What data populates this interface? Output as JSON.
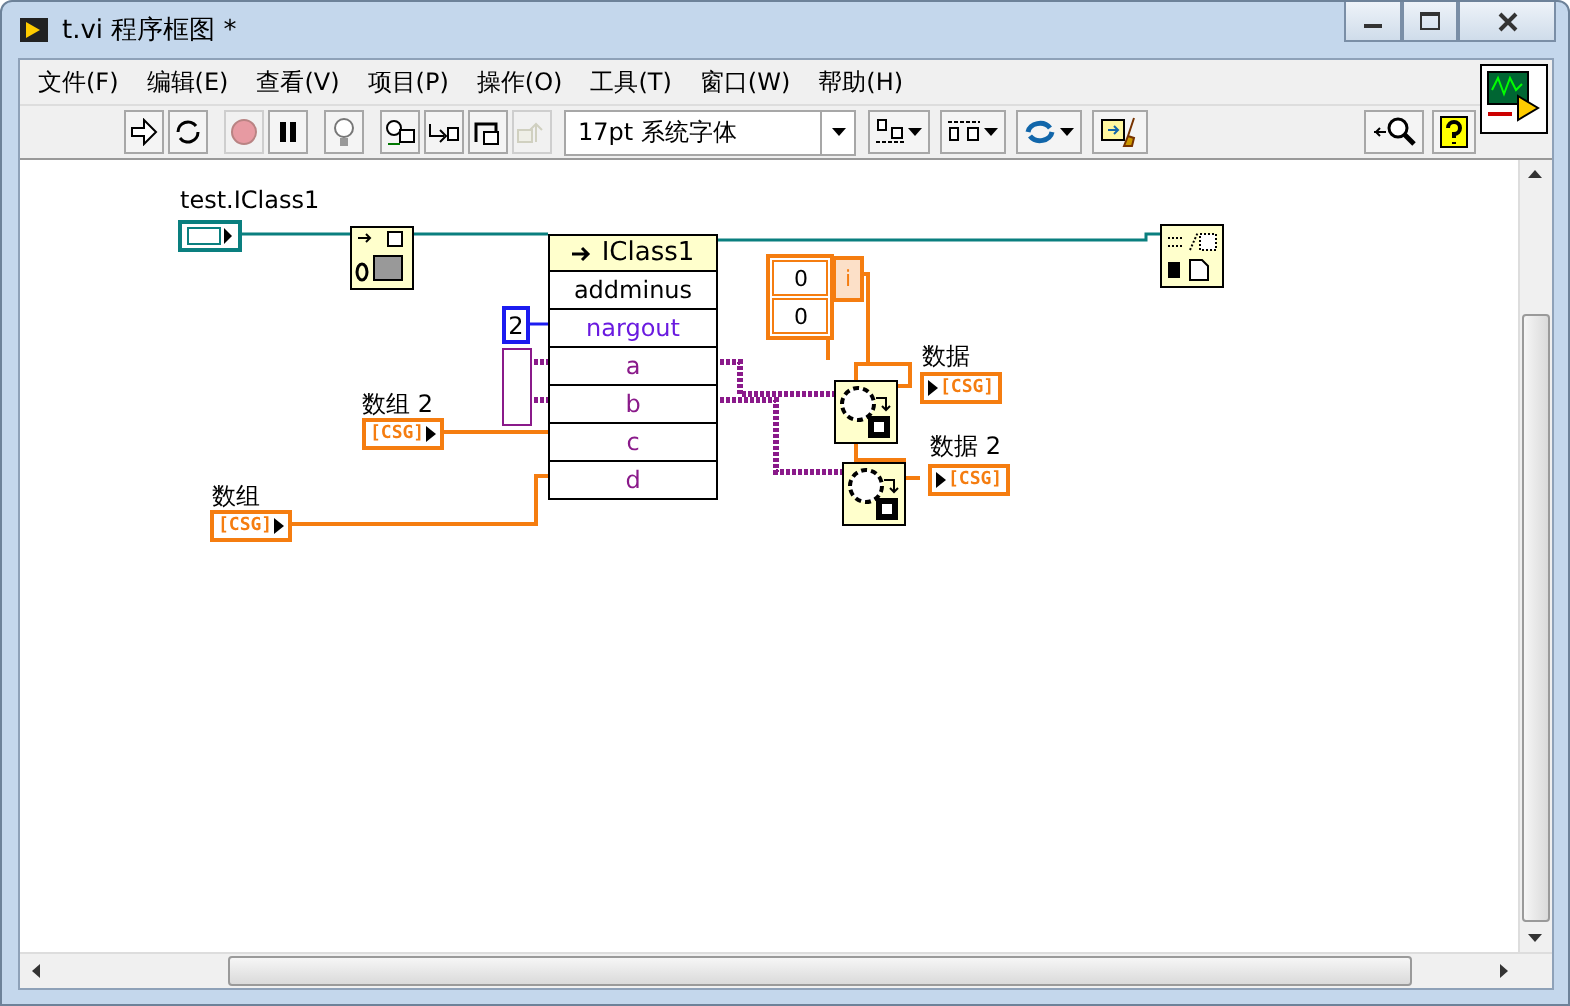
{
  "window": {
    "title": "t.vi 程序框图 *"
  },
  "menu": [
    "文件(F)",
    "编辑(E)",
    "查看(V)",
    "项目(P)",
    "操作(O)",
    "工具(T)",
    "窗口(W)",
    "帮助(H)"
  ],
  "toolbar": {
    "buttons": [
      {
        "kind": "run",
        "disabled": false
      },
      {
        "kind": "run-continuous",
        "disabled": false
      },
      {
        "kind": "abort",
        "disabled": true
      },
      {
        "kind": "pause",
        "disabled": false
      },
      {
        "kind": "highlight",
        "disabled": false
      },
      {
        "kind": "retain",
        "disabled": false
      },
      {
        "kind": "step-into",
        "disabled": false
      },
      {
        "kind": "step-over",
        "disabled": false
      },
      {
        "kind": "step-out",
        "disabled": true
      }
    ],
    "font": "17pt 系统字体",
    "tools": [
      {
        "kind": "align"
      },
      {
        "kind": "distribute"
      },
      {
        "kind": "reorder"
      },
      {
        "kind": "cleanup"
      }
    ],
    "right_tools": [
      {
        "kind": "search"
      },
      {
        "kind": "help"
      }
    ]
  },
  "diagram": {
    "class_constant": {
      "label": "test.IClass1"
    },
    "numeric_constant": "2",
    "controls": [
      {
        "label": "数组 2",
        "text": "[CSG]"
      },
      {
        "label": "数组",
        "text": "[CSG]"
      }
    ],
    "indicators": [
      {
        "label": "数据",
        "text": "[CSG]"
      },
      {
        "label": "数据 2",
        "text": "[CSG]"
      }
    ],
    "array_constant": {
      "values": [
        "0",
        "0"
      ]
    },
    "index_constant": "i",
    "method_node": {
      "class": "IClass1",
      "method": "addminus",
      "params": [
        "nargout",
        "a",
        "b",
        "c",
        "d"
      ]
    }
  }
}
